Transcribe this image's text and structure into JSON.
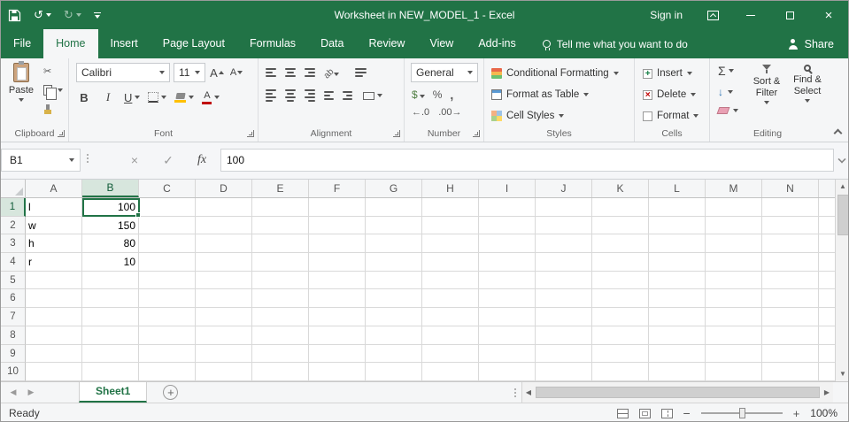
{
  "title_bar": {
    "title": "Worksheet in NEW_MODEL_1 - Excel",
    "sign_in": "Sign in"
  },
  "ribbon_tabs": [
    {
      "id": "file",
      "label": "File",
      "active": false
    },
    {
      "id": "home",
      "label": "Home",
      "active": true
    },
    {
      "id": "insert",
      "label": "Insert",
      "active": false
    },
    {
      "id": "page-layout",
      "label": "Page Layout",
      "active": false
    },
    {
      "id": "formulas",
      "label": "Formulas",
      "active": false
    },
    {
      "id": "data",
      "label": "Data",
      "active": false
    },
    {
      "id": "review",
      "label": "Review",
      "active": false
    },
    {
      "id": "view",
      "label": "View",
      "active": false
    },
    {
      "id": "add-ins",
      "label": "Add-ins",
      "active": false
    }
  ],
  "tell_me": "Tell me what you want to do",
  "share_label": "Share",
  "ribbon": {
    "clipboard": {
      "label": "Clipboard",
      "paste": "Paste"
    },
    "font": {
      "label": "Font",
      "name": "Calibri",
      "size": "11",
      "bold": "B",
      "italic": "I",
      "underline": "U",
      "grow": "A",
      "shrink": "A",
      "font_color": "A"
    },
    "alignment": {
      "label": "Alignment",
      "orientation": "ab"
    },
    "number": {
      "label": "Number",
      "format": "General",
      "accounting": "$",
      "percent": "%",
      "comma": ",",
      "inc_decimal": "←.0",
      "dec_decimal": ".00→"
    },
    "styles": {
      "label": "Styles",
      "conditional": "Conditional Formatting",
      "table": "Format as Table",
      "cell_styles": "Cell Styles"
    },
    "cells": {
      "label": "Cells",
      "insert": "Insert",
      "delete": "Delete",
      "format": "Format"
    },
    "editing": {
      "label": "Editing",
      "autosum": "Σ",
      "sort_filter": "Sort & Filter",
      "find_select": "Find & Select"
    }
  },
  "formula_bar": {
    "name_box": "B1",
    "cancel": "×",
    "enter": "✓",
    "fx": "fx",
    "value": "100"
  },
  "grid": {
    "columns": [
      "A",
      "B",
      "C",
      "D",
      "E",
      "F",
      "G",
      "H",
      "I",
      "J",
      "K",
      "L",
      "M",
      "N"
    ],
    "row_count": 10,
    "selected_cell": "B1",
    "selected_column": "B",
    "selected_row": 1,
    "cells": {
      "A1": "l",
      "B1": "100",
      "A2": "w",
      "B2": "150",
      "A3": "h",
      "B3": "80",
      "A4": "r",
      "B4": "10"
    }
  },
  "sheet_bar": {
    "active_sheet": "Sheet1",
    "add": "+"
  },
  "status_bar": {
    "status": "Ready",
    "zoom": "100%",
    "zoom_out": "−",
    "zoom_in": "+"
  },
  "icons": {
    "undo": "↺",
    "redo": "↻",
    "close": "×",
    "scissors": "✂",
    "sigma": "Σ",
    "fill_down": "↓",
    "plus": "+",
    "delete_x": "×",
    "up": "▲",
    "down": "▼",
    "left": "◀",
    "right": "▶"
  }
}
